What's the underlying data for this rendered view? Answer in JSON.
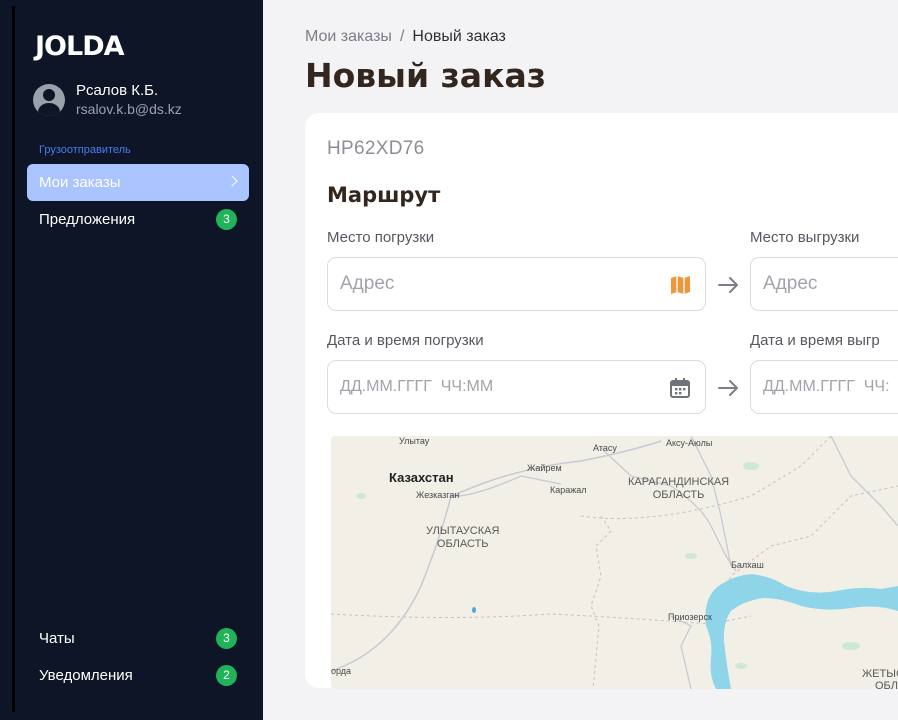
{
  "sidebar": {
    "logo": "JOLDA",
    "user": {
      "name": "Рсалов К.Б.",
      "email": "rsalov.k.b@ds.kz"
    },
    "role_label": "Грузоотправитель",
    "items": [
      {
        "label": "Мои заказы",
        "active": true
      },
      {
        "label": "Предложения",
        "badge": "3"
      }
    ],
    "bottom_items": [
      {
        "label": "Чаты",
        "badge": "3"
      },
      {
        "label": "Уведомления",
        "badge": "2"
      }
    ],
    "colors": {
      "background": "#0d1526",
      "active": "#a9c4ff",
      "badge": "#21b35a",
      "role": "#4b7cf2"
    }
  },
  "breadcrumb": {
    "parent": "Мои заказы",
    "separator": "/",
    "current": "Новый заказ"
  },
  "page_title": "Новый заказ",
  "order": {
    "id": "HP62XD76",
    "route_title": "Маршрут",
    "loading_place": {
      "label": "Место погрузки",
      "placeholder": "Адрес",
      "icon": "map-icon"
    },
    "unloading_place": {
      "label": "Место выгрузки",
      "placeholder": "Адрес"
    },
    "loading_datetime": {
      "label": "Дата и время погрузки",
      "placeholder": "ДД.ММ.ГГГГ  ЧЧ:ММ",
      "icon": "calendar-icon"
    },
    "unloading_datetime": {
      "label": "Дата и время выгр",
      "placeholder": "ДД.ММ.ГГГГ  ЧЧ:"
    }
  },
  "map": {
    "labels": {
      "country": "Казахстан",
      "ulytau": "Улытау",
      "zhezkazgan": "Жезказган",
      "zhairem": "Жайрем",
      "karazhal": "Каражал",
      "atasu": "Атасу",
      "aksu_ayuly": "Аксу-Аюлы",
      "karaganda_region": "КАРАГАНДИНСКАЯ\nОБЛАСТЬ",
      "ulytau_region": "УЛЫТАУСКАЯ\nОБЛАСТЬ",
      "balkhash": "Балхаш",
      "priozersk": "Приозерск",
      "korda": "орда",
      "zhetysu": "ЖЕТЫС",
      "zhetysu_obl": "ОБЛ"
    },
    "colors": {
      "land": "#f1efe6",
      "water": "#8fd5ea",
      "roads": "#c9c9d4"
    }
  }
}
